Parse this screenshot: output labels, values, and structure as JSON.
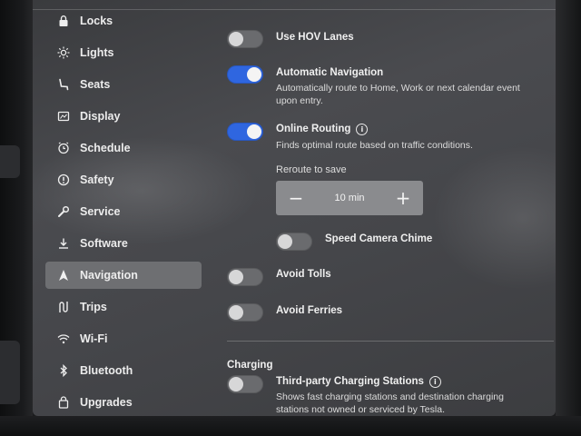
{
  "sidebar": {
    "items": [
      {
        "label": "Locks",
        "icon": "lock-icon"
      },
      {
        "label": "Lights",
        "icon": "lights-icon"
      },
      {
        "label": "Seats",
        "icon": "seat-icon"
      },
      {
        "label": "Display",
        "icon": "display-icon"
      },
      {
        "label": "Schedule",
        "icon": "schedule-icon"
      },
      {
        "label": "Safety",
        "icon": "safety-icon"
      },
      {
        "label": "Service",
        "icon": "wrench-icon"
      },
      {
        "label": "Software",
        "icon": "download-icon"
      },
      {
        "label": "Navigation",
        "icon": "navigation-icon"
      },
      {
        "label": "Trips",
        "icon": "trips-icon"
      },
      {
        "label": "Wi-Fi",
        "icon": "wifi-icon"
      },
      {
        "label": "Bluetooth",
        "icon": "bluetooth-icon"
      },
      {
        "label": "Upgrades",
        "icon": "upgrades-icon"
      }
    ],
    "active": "Navigation"
  },
  "navigation": {
    "hov": {
      "title": "Use HOV Lanes",
      "on": false
    },
    "auto_nav": {
      "title": "Automatic Navigation",
      "desc": "Automatically route to Home, Work or next calendar event upon entry.",
      "on": true
    },
    "online_routing": {
      "title": "Online Routing",
      "desc": "Finds optimal route based on traffic conditions.",
      "on": true
    },
    "reroute": {
      "label": "Reroute to save",
      "value": "10 min",
      "minus": "−",
      "plus": "+"
    },
    "speed_camera": {
      "title": "Speed Camera Chime",
      "on": false
    },
    "avoid_tolls": {
      "title": "Avoid Tolls",
      "on": false
    },
    "avoid_ferries": {
      "title": "Avoid Ferries",
      "on": false
    }
  },
  "charging": {
    "section_title": "Charging",
    "third_party": {
      "title": "Third-party Charging Stations",
      "desc": "Shows fast charging stations and destination charging stations not owned or serviced by Tesla.",
      "on": false
    }
  },
  "colors": {
    "toggle_on": "#2f66e0",
    "toggle_off": "#6a6b6e",
    "active_item": "#6e6f72"
  }
}
